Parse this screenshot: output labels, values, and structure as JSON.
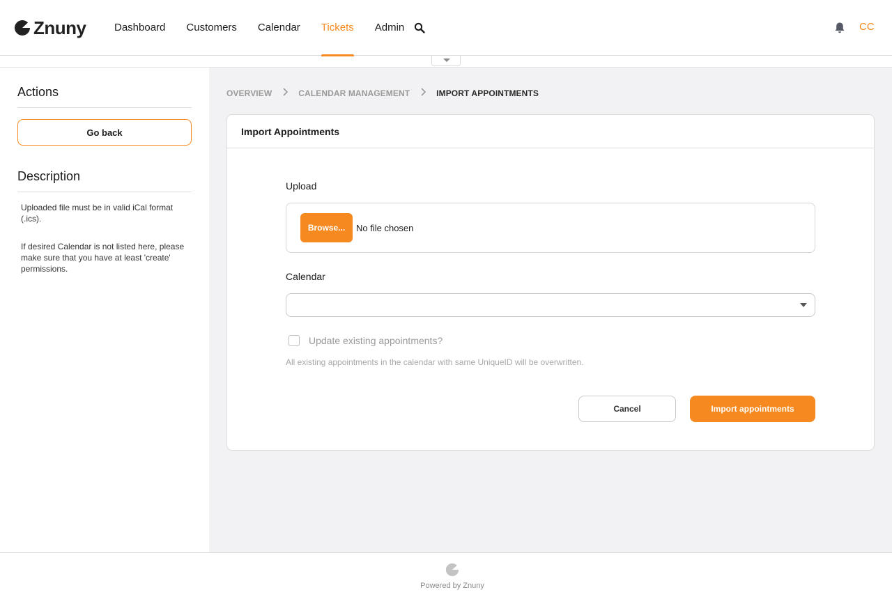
{
  "brand": {
    "name": "Znuny",
    "accent": "#f6891f"
  },
  "nav": {
    "items": [
      {
        "label": "Dashboard",
        "active": false
      },
      {
        "label": "Customers",
        "active": false
      },
      {
        "label": "Calendar",
        "active": false
      },
      {
        "label": "Tickets",
        "active": true
      },
      {
        "label": "Admin",
        "active": false
      }
    ],
    "search_icon": "search-icon",
    "bell_icon": "bell-icon",
    "user_initials": "CC"
  },
  "sidebar": {
    "actions_title": "Actions",
    "go_back_label": "Go back",
    "description_title": "Description",
    "description_1": "Uploaded file must be in valid iCal format (.ics).",
    "description_2": "If desired Calendar is not listed here, please make sure that you have at least 'create' permissions."
  },
  "breadcrumb": {
    "items": [
      "OVERVIEW",
      "CALENDAR MANAGEMENT"
    ],
    "current": "IMPORT APPOINTMENTS"
  },
  "form": {
    "title": "Import Appointments",
    "upload_label": "Upload",
    "browse_label": "Browse...",
    "file_status": "No file chosen",
    "calendar_label": "Calendar",
    "calendar_value": "",
    "update_label": "Update existing appointments?",
    "update_checked": false,
    "update_hint": "All existing appointments in the calendar with same UniqueID will be overwritten.",
    "cancel_label": "Cancel",
    "import_label": "Import appointments"
  },
  "footer": {
    "text": "Powered by Znuny"
  }
}
